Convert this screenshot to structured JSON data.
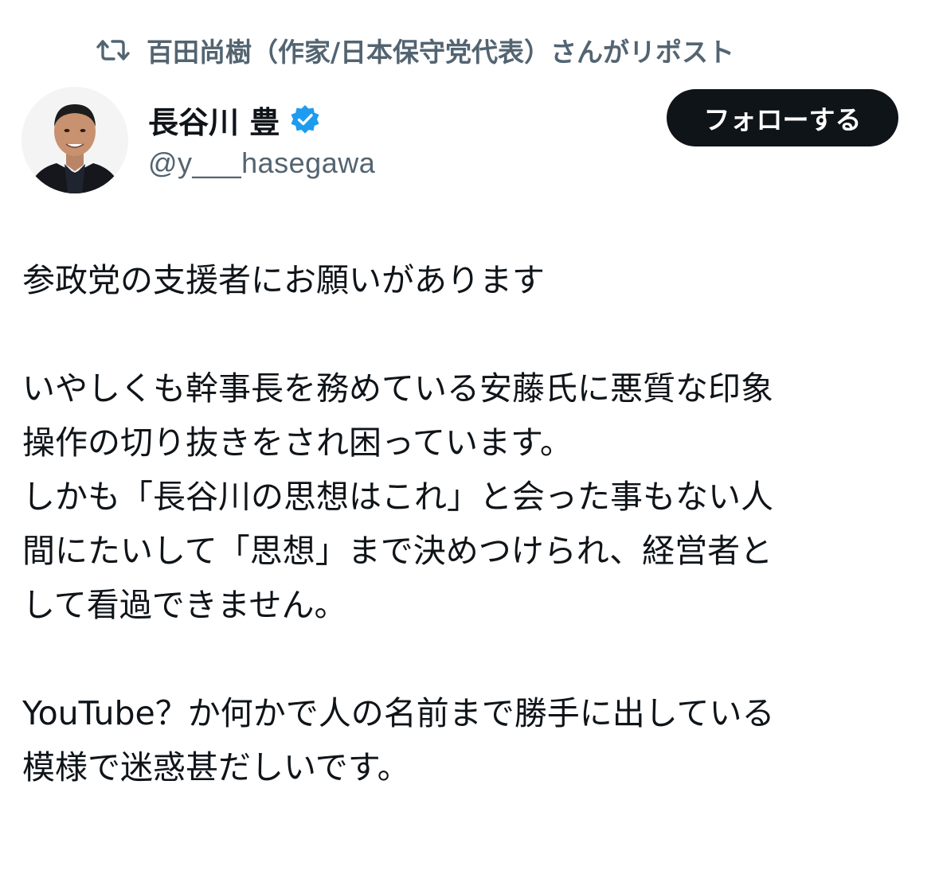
{
  "repost": {
    "icon": "repost-icon",
    "text": "百田尚樹（作家/日本保守党代表）さんがリポスト"
  },
  "author": {
    "display_name": "長谷川 豊",
    "verified_icon": "verified-badge-icon",
    "handle": "@y___hasegawa",
    "avatar": "avatar"
  },
  "follow_button": {
    "label": "フォローする"
  },
  "tweet": {
    "paragraphs": [
      [
        "参政党の支援者にお願いがあります"
      ],
      [
        "いやしくも幹事長を務めている安藤氏に悪質な印象",
        "操作の切り抜きをされ困っています。",
        "しかも「長谷川の思想はこれ」と会った事もない人",
        "間にたいして「思想」まで決めつけられ、経営者と",
        "して看過できません。"
      ],
      [
        "YouTube？か何かで人の名前まで勝手に出している",
        "模様で迷惑甚だしいです。"
      ]
    ]
  },
  "colors": {
    "text_primary": "#0f1419",
    "text_secondary": "#536471",
    "button_bg": "#0f1419",
    "verified_blue": "#1d9bf0"
  }
}
